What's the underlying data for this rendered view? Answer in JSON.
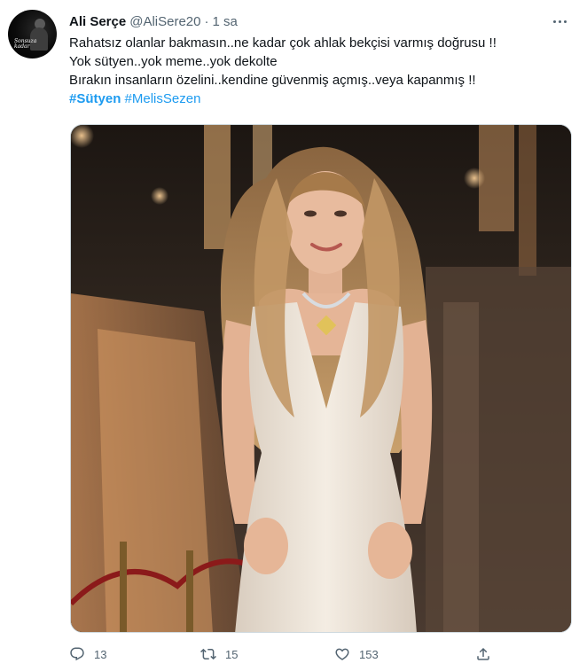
{
  "author": {
    "name": "Ali Serçe",
    "handle": "@AliSere20",
    "separator": "·",
    "time": "1 sa",
    "avatar_text": "Sonsuza kadar"
  },
  "tweet": {
    "lines": [
      "Rahatsız olanlar bakmasın..ne kadar çok ahlak bekçisi varmış doğrusu !!",
      "Yok sütyen..yok meme..yok dekolte",
      "Bırakın insanların özelini..kendine güvenmiş açmış..veya kapanmış !!"
    ],
    "hashtags": [
      "#Sütyen",
      "#MelisSezen"
    ]
  },
  "media": {
    "description_icon": "photo",
    "colors": {
      "background_dark": "#2a211b",
      "background_warm": "#a3704a",
      "dress": "#efe6da",
      "hair": "#b48a58",
      "skin": "#e6b79a"
    }
  },
  "actions": {
    "reply": {
      "icon": "reply-icon",
      "count": "13"
    },
    "retweet": {
      "icon": "retweet-icon",
      "count": "15"
    },
    "like": {
      "icon": "heart-icon",
      "count": "153"
    },
    "share": {
      "icon": "share-icon"
    }
  },
  "colors": {
    "link": "#1d9bf0",
    "secondary_text": "#536471",
    "primary_text": "#0f1419"
  }
}
